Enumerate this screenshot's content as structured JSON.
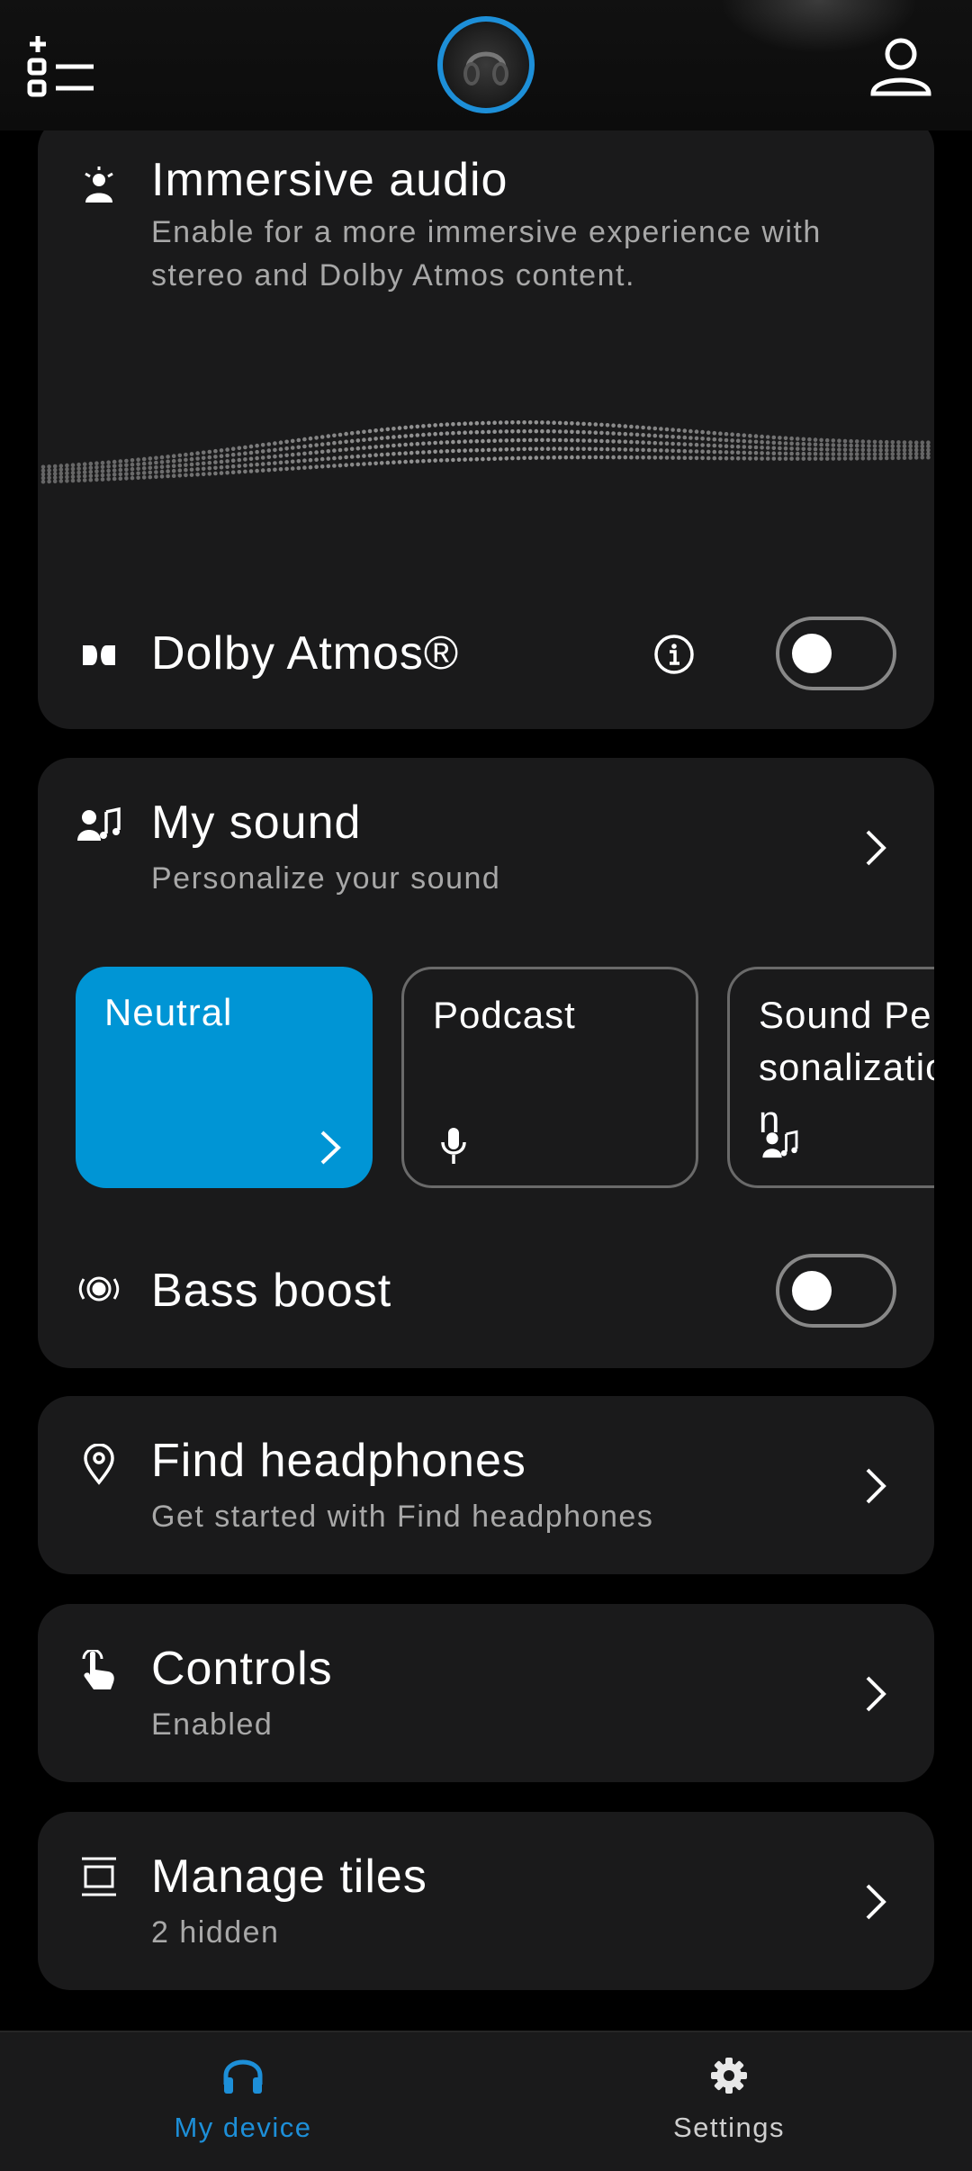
{
  "header": {
    "menu_icon": "add-list-icon",
    "device_icon": "headphones-avatar",
    "profile_icon": "person-icon"
  },
  "immersive": {
    "title": "Immersive audio",
    "description": "Enable for a more immersive experience with stereo and Dolby Atmos content.",
    "dolby_label": "Dolby Atmos®",
    "dolby_enabled": false
  },
  "my_sound": {
    "title": "My sound",
    "subtitle": "Personalize your sound",
    "presets": [
      {
        "label": "Neutral",
        "selected": true,
        "icon": "chevron-right-icon"
      },
      {
        "label": "Podcast",
        "selected": false,
        "icon": "microphone-icon"
      },
      {
        "label": "Sound Personalization",
        "selected": false,
        "icon": "person-music-icon"
      }
    ],
    "bass_boost_label": "Bass boost",
    "bass_boost_enabled": false
  },
  "find": {
    "title": "Find headphones",
    "subtitle": "Get started with Find headphones"
  },
  "controls": {
    "title": "Controls",
    "subtitle": "Enabled"
  },
  "tiles": {
    "title": "Manage tiles",
    "subtitle": "2 hidden"
  },
  "nav": {
    "items": [
      {
        "label": "My device",
        "icon": "headphones-icon",
        "active": true
      },
      {
        "label": "Settings",
        "icon": "gear-icon",
        "active": false
      }
    ]
  },
  "colors": {
    "accent": "#1d8fd8",
    "preset_selected": "#0095d5",
    "card": "#1a1a1b"
  }
}
